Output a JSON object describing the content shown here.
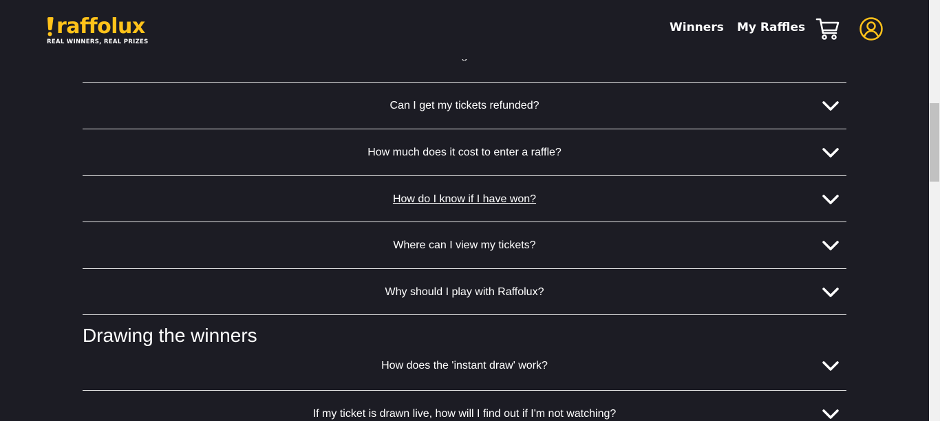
{
  "header": {
    "logo_text": "raffolux",
    "logo_tagline": "REAL WINNERS, REAL PRIZES",
    "nav": {
      "winners": "Winners",
      "my_raffles": "My Raffles"
    },
    "icons": {
      "cart": "cart-icon",
      "account": "account-icon"
    }
  },
  "faq": {
    "partial_above": "g",
    "items": [
      {
        "question": "Can I get my tickets refunded?"
      },
      {
        "question": "How much does it cost to enter a raffle?"
      },
      {
        "question": "How do I know if I have won?"
      },
      {
        "question": "Where can I view my tickets?"
      },
      {
        "question": "Why should I play with Raffolux?"
      }
    ],
    "section_title": "Drawing the winners",
    "section_items": [
      {
        "question": "How does the 'instant draw' work?"
      },
      {
        "question": "If my ticket is drawn live, how will I find out if I'm not watching?"
      }
    ]
  },
  "colors": {
    "background": "#1c1c24",
    "brand_yellow": "#ffc21a",
    "text": "#ffffff",
    "divider": "#e6e6e6"
  }
}
